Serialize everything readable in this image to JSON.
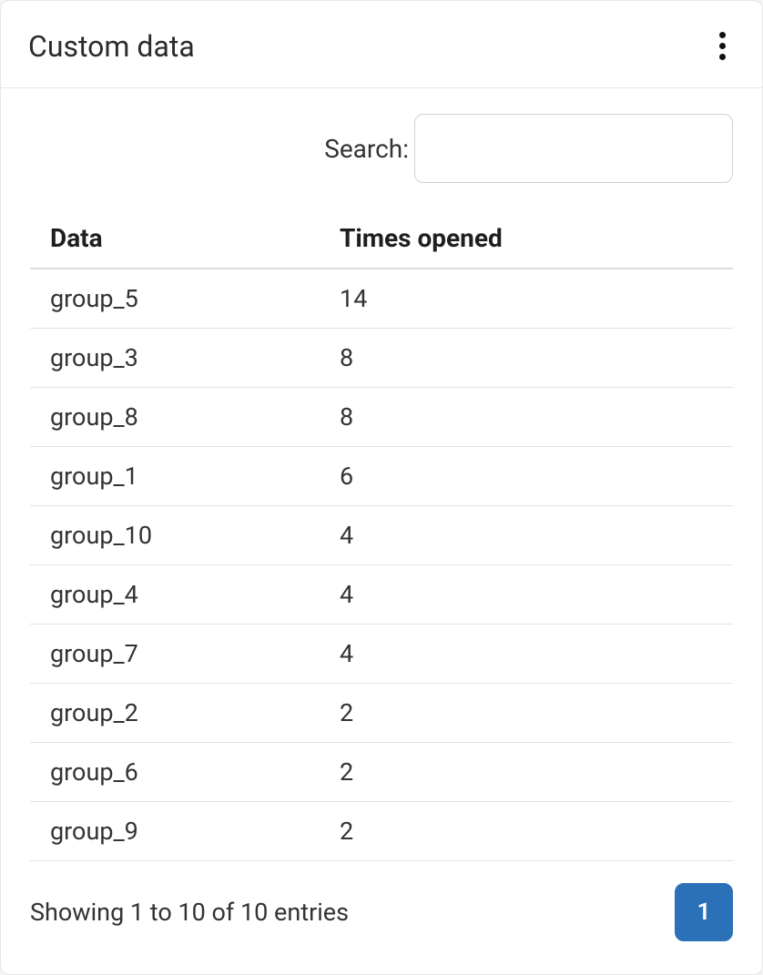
{
  "header": {
    "title": "Custom data"
  },
  "search": {
    "label": "Search:",
    "value": ""
  },
  "table": {
    "columns": [
      "Data",
      "Times opened"
    ],
    "rows": [
      {
        "data": "group_5",
        "times": "14"
      },
      {
        "data": "group_3",
        "times": "8"
      },
      {
        "data": "group_8",
        "times": "8"
      },
      {
        "data": "group_1",
        "times": "6"
      },
      {
        "data": "group_10",
        "times": "4"
      },
      {
        "data": "group_4",
        "times": "4"
      },
      {
        "data": "group_7",
        "times": "4"
      },
      {
        "data": "group_2",
        "times": "2"
      },
      {
        "data": "group_6",
        "times": "2"
      },
      {
        "data": "group_9",
        "times": "2"
      }
    ]
  },
  "footer": {
    "info": "Showing 1 to 10 of 10 entries"
  },
  "pagination": {
    "pages": [
      "1"
    ],
    "current": "1"
  }
}
